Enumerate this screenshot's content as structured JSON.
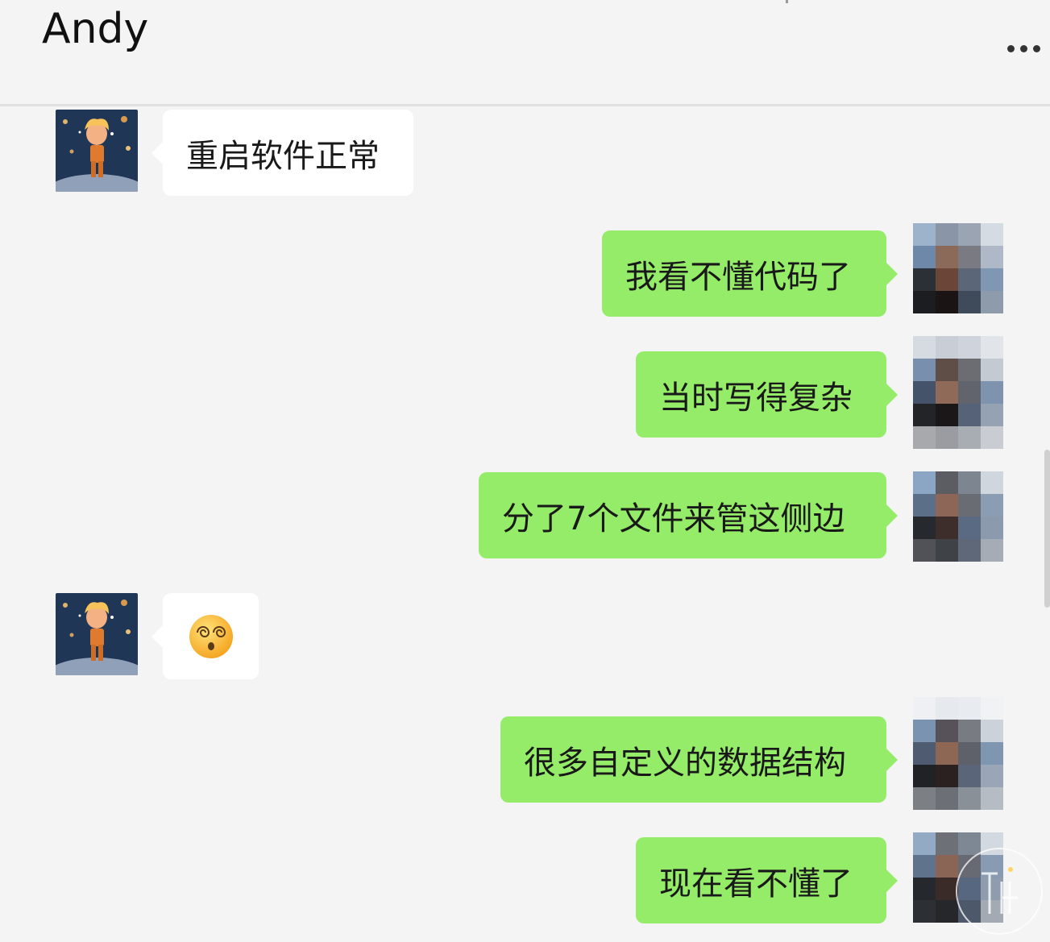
{
  "header": {
    "contact_name": "Andy",
    "more_icon": "ellipsis-icon"
  },
  "messages": [
    {
      "direction": "incoming",
      "text": "重启软件正常"
    },
    {
      "direction": "outgoing",
      "text": "我看不懂代码了"
    },
    {
      "direction": "outgoing",
      "text": "当时写得复杂"
    },
    {
      "direction": "outgoing",
      "text": "分了7个文件来管这侧边"
    },
    {
      "direction": "incoming",
      "text": "😵‍💫",
      "type": "emoji",
      "emoji_name": "face-with-spiral-eyes"
    },
    {
      "direction": "outgoing",
      "text": "很多自定义的数据结构"
    },
    {
      "direction": "outgoing",
      "text": "现在看不懂了"
    }
  ],
  "colors": {
    "background": "#f4f4f4",
    "incoming_bubble": "#ffffff",
    "outgoing_bubble": "#95ec69",
    "text": "#191919"
  },
  "avatars": {
    "incoming": "cartoon-boy-space-avatar",
    "outgoing": "pixelated-avatar"
  }
}
